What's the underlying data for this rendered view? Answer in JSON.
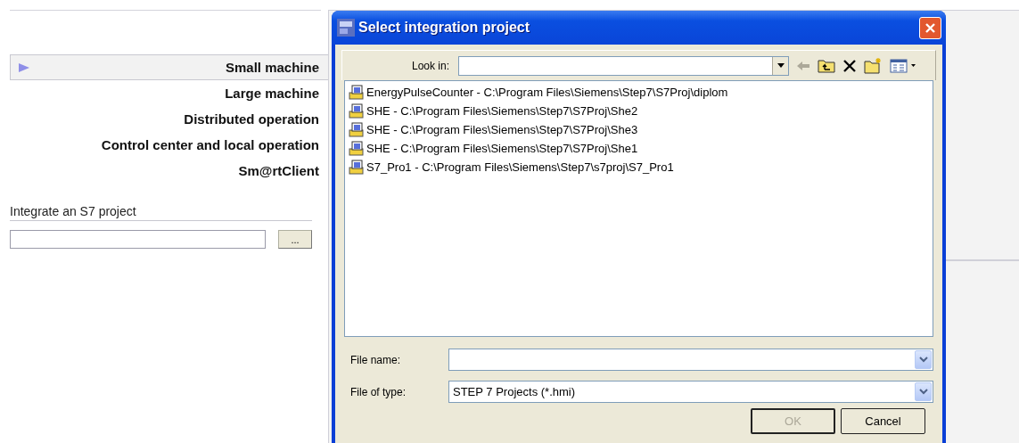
{
  "sidebar": {
    "items": [
      {
        "label": "Small machine",
        "selected": true
      },
      {
        "label": "Large machine",
        "selected": false
      },
      {
        "label": "Distributed operation",
        "selected": false
      },
      {
        "label": "Control center and local operation",
        "selected": false
      },
      {
        "label": "Sm@rtClient",
        "selected": false
      }
    ]
  },
  "integrate": {
    "heading": "Integrate an S7 project",
    "browse_button": "..."
  },
  "dialog": {
    "title": "Select integration project",
    "look_in": {
      "label": "Look in:"
    },
    "files": [
      {
        "name": "EnergyPulseCounter - C:\\Program Files\\Siemens\\Step7\\S7Proj\\diplom"
      },
      {
        "name": "SHE - C:\\Program Files\\Siemens\\Step7\\S7Proj\\She2"
      },
      {
        "name": "SHE - C:\\Program Files\\Siemens\\Step7\\S7Proj\\She3"
      },
      {
        "name": "SHE - C:\\Program Files\\Siemens\\Step7\\S7Proj\\She1"
      },
      {
        "name": "S7_Pro1 - C:\\Program Files\\Siemens\\Step7\\s7proj\\S7_Pro1"
      }
    ],
    "file_name": {
      "label": "File name:"
    },
    "file_type": {
      "label": "File of type:",
      "value": "STEP 7 Projects (*.hmi)"
    },
    "buttons": [
      {
        "label": "OK",
        "disabled": true
      },
      {
        "label": "Cancel",
        "disabled": false
      }
    ]
  }
}
